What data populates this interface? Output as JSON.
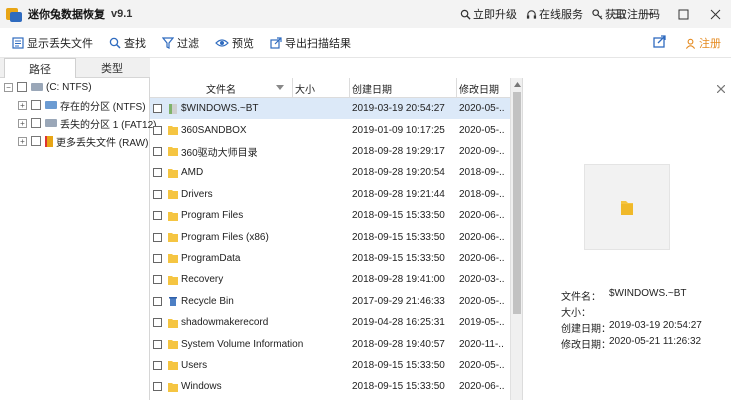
{
  "app": {
    "title": "迷你兔数据恢复",
    "version": "v9.1"
  },
  "title_links": [
    {
      "icon": "search-icon",
      "label": "立即升级"
    },
    {
      "icon": "headset-icon",
      "label": "在线服务"
    },
    {
      "icon": "key-icon",
      "label": "获取注册码"
    }
  ],
  "toolbar": {
    "show_lost": "显示丢失文件",
    "find": "查找",
    "filter": "过滤",
    "preview": "预览",
    "export": "导出扫描结果",
    "register": "注册"
  },
  "left_tabs": [
    "路径",
    "类型"
  ],
  "tree": [
    {
      "label": "(C: NTFS)",
      "color": "#9aa7b8"
    },
    {
      "label": "存在的分区 (NTFS)",
      "color": "#6b9bd2"
    },
    {
      "label": "丢失的分区 1 (FAT12)",
      "color": "#9aa7b8"
    },
    {
      "label": "更多丢失文件 (RAW)",
      "color": "#e8a515"
    }
  ],
  "columns": {
    "name": "文件名",
    "size": "大小",
    "created": "创建日期",
    "modified": "修改日期"
  },
  "files": [
    {
      "name": "$WINDOWS.~BT",
      "created": "2019-03-19 20:54:27",
      "modified": "2020-05-..",
      "icon": "file"
    },
    {
      "name": "360SANDBOX",
      "created": "2019-01-09 10:17:25",
      "modified": "2020-05-..",
      "icon": "folder"
    },
    {
      "name": "360驱动大师目录",
      "created": "2018-09-28 19:29:17",
      "modified": "2020-09-..",
      "icon": "folder"
    },
    {
      "name": "AMD",
      "created": "2018-09-28 19:20:54",
      "modified": "2018-09-..",
      "icon": "folder"
    },
    {
      "name": "Drivers",
      "created": "2018-09-28 19:21:44",
      "modified": "2018-09-..",
      "icon": "folder"
    },
    {
      "name": "Program Files",
      "created": "2018-09-15 15:33:50",
      "modified": "2020-06-..",
      "icon": "folder"
    },
    {
      "name": "Program Files (x86)",
      "created": "2018-09-15 15:33:50",
      "modified": "2020-06-..",
      "icon": "folder"
    },
    {
      "name": "ProgramData",
      "created": "2018-09-15 15:33:50",
      "modified": "2020-06-..",
      "icon": "folder"
    },
    {
      "name": "Recovery",
      "created": "2018-09-28 19:41:00",
      "modified": "2020-03-..",
      "icon": "folder"
    },
    {
      "name": "Recycle Bin",
      "created": "2017-09-29 21:46:33",
      "modified": "2020-05-..",
      "icon": "recycle"
    },
    {
      "name": "shadowmakerecord",
      "created": "2019-04-28 16:25:31",
      "modified": "2019-05-..",
      "icon": "folder"
    },
    {
      "name": "System Volume Information",
      "created": "2018-09-28 19:40:57",
      "modified": "2020-11-..",
      "icon": "folder"
    },
    {
      "name": "Users",
      "created": "2018-09-15 15:33:50",
      "modified": "2020-05-..",
      "icon": "folder"
    },
    {
      "name": "Windows",
      "created": "2018-09-15 15:33:50",
      "modified": "2020-06-..",
      "icon": "folder"
    }
  ],
  "preview": {
    "name_label": "文件名：",
    "name_value": "$WINDOWS.~BT",
    "size_label": "大小：",
    "size_value": "",
    "created_label": "创建日期：",
    "created_value": "2019-03-19 20:54:27",
    "modified_label": "修改日期：",
    "modified_value": "2020-05-21 11:26:32"
  },
  "colors": {
    "folder": "#f5c542",
    "accent": "#2f6bbf",
    "register": "#e58a1f",
    "selected_row": "#dce9f8"
  }
}
